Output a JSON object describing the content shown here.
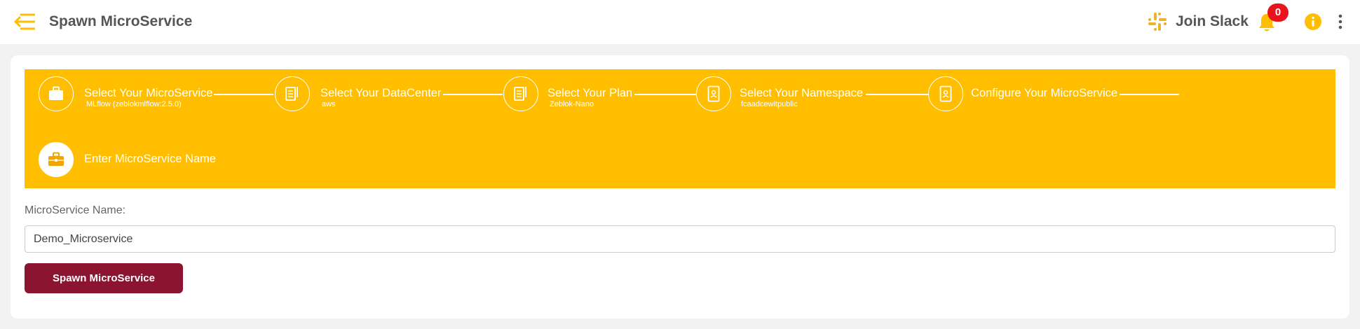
{
  "header": {
    "title": "Spawn MicroService",
    "join_slack": "Join Slack",
    "notification_count": "0"
  },
  "stepper": {
    "steps": [
      {
        "title": "Select Your MicroService",
        "subtitle": "MLflow (zeblokmlflow:2.5.0)",
        "icon": "briefcase-icon"
      },
      {
        "title": "Select Your DataCenter",
        "subtitle": "aws",
        "icon": "document-icon"
      },
      {
        "title": "Select Your Plan",
        "subtitle": "Zeblok-Nano",
        "icon": "document-icon"
      },
      {
        "title": "Select Your Namespace",
        "subtitle": "fcaadcewitpublic",
        "icon": "id-badge-icon"
      },
      {
        "title": "Configure Your MicroService",
        "subtitle": "",
        "icon": "id-badge-icon"
      },
      {
        "title": "Enter MicroService Name",
        "subtitle": "",
        "icon": "briefcase-icon"
      }
    ],
    "active_step": 6
  },
  "form": {
    "name_label": "MicroService Name:",
    "name_value": "Demo_Microservice",
    "submit_label": "Spawn MicroService"
  },
  "colors": {
    "accent": "#ffbf00",
    "button": "#8b1430",
    "badge": "#e8131b",
    "slack": "#ecb22e"
  }
}
